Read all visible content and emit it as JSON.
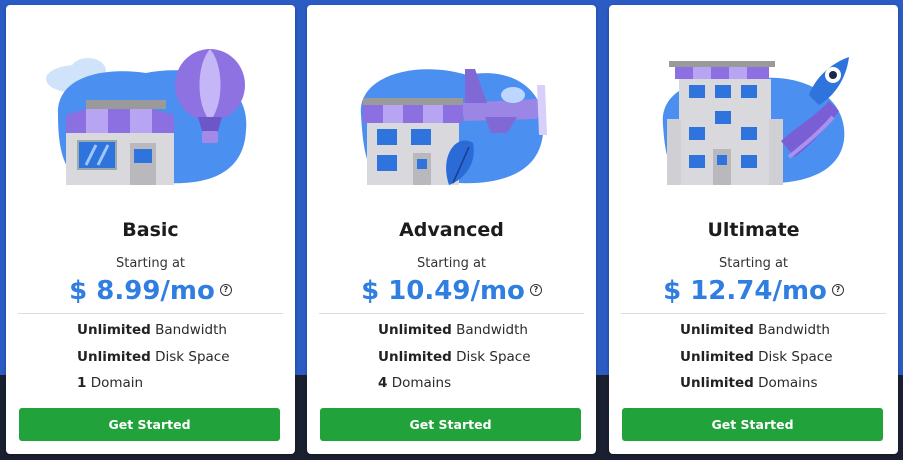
{
  "plans": [
    {
      "name": "Basic",
      "starting_label": "Starting at",
      "price": "$ 8.99/mo",
      "help_icon": "?",
      "features": [
        {
          "strong": "Unlimited",
          "rest": "Bandwidth"
        },
        {
          "strong": "Unlimited",
          "rest": "Disk Space"
        },
        {
          "strong": "1",
          "rest": "Domain"
        }
      ],
      "cta": "Get Started",
      "illustration": "storefront-balloon-icon"
    },
    {
      "name": "Advanced",
      "starting_label": "Starting at",
      "price": "$ 10.49/mo",
      "help_icon": "?",
      "features": [
        {
          "strong": "Unlimited",
          "rest": "Bandwidth"
        },
        {
          "strong": "Unlimited",
          "rest": "Disk Space"
        },
        {
          "strong": "4",
          "rest": "Domains"
        }
      ],
      "cta": "Get Started",
      "illustration": "store-airplane-icon"
    },
    {
      "name": "Ultimate",
      "starting_label": "Starting at",
      "price": "$ 12.74/mo",
      "help_icon": "?",
      "features": [
        {
          "strong": "Unlimited",
          "rest": "Bandwidth"
        },
        {
          "strong": "Unlimited",
          "rest": "Disk Space"
        },
        {
          "strong": "Unlimited",
          "rest": "Domains"
        }
      ],
      "cta": "Get Started",
      "illustration": "building-rocket-icon"
    }
  ],
  "colors": {
    "background": "#2b5cc4",
    "price": "#2f7ee0",
    "cta": "#22a23b",
    "card": "#ffffff"
  }
}
